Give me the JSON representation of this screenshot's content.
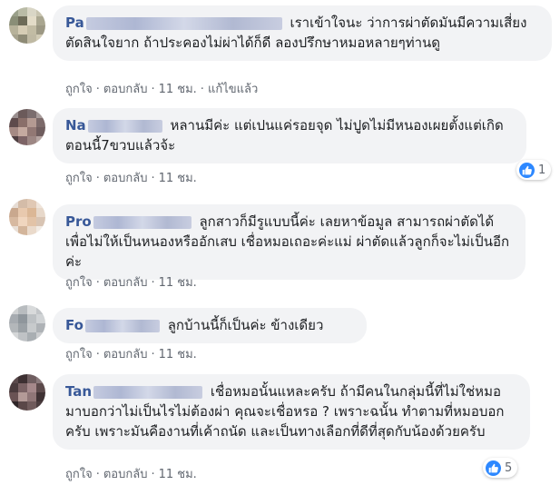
{
  "actions": {
    "like": "ถูกใจ",
    "reply": "ตอบกลับ",
    "edited": "แก้ไขแล้ว",
    "separator": "·"
  },
  "comments": [
    {
      "name": "Pa",
      "text": "เราเข้าใจนะ ว่าการผ่าตัดมันมีความเสี่ยง ตัดสินใจยาก ถ้าประคองไม่ผ่าได้ก็ดี ลองปรึกษาหมอหลายๆท่านดู",
      "time": "11 ชม.",
      "reactions": ""
    },
    {
      "name": "Na",
      "text": "หลานมีค่ะ แต่เปนแค่รอยจุด ไม่ปูดไม่มีหนองเผยตั้งแต่เกิดตอนนี้7ขวบแล้วจ้ะ",
      "time": "11 ชม.",
      "reactions": "1"
    },
    {
      "name": "Pro",
      "text": "ลูกสาวก็มีรูแบบนี้ค่ะ เลยหาข้อมูล สามารถผ่าตัดได้เพื่อไม่ให้เป็นหนองหรืออักเสบ เชื่อหมอเถอะค่ะแม่ ผ่าตัดแล้วลูกก็จะไม่เป็นอีกค่ะ",
      "time": "11 ชม.",
      "reactions": ""
    },
    {
      "name": "Fo",
      "text": "ลูกบ้านนี้ก็เป็นค่ะ ข้างเดียว",
      "time": "11 ชม.",
      "reactions": ""
    },
    {
      "name": "Tan",
      "text": "เชื่อหมอนั้นแหละครับ ถ้ามีคนในกลุ่มนี้ที่ไม่ใช่หมอมาบอกว่าไม่เป็นไรไม่ต้องผ่า คุณจะเชื่อหรอ ? เพราะฉนั้น ทำตามที่หมอบอกครับ เพราะมันคืองานที่เค้าถนัด และเป็นทางเลือกที่ดีที่สุดกับน้องด้วยครับ",
      "time": "11 ชม.",
      "reactions": "5"
    }
  ]
}
